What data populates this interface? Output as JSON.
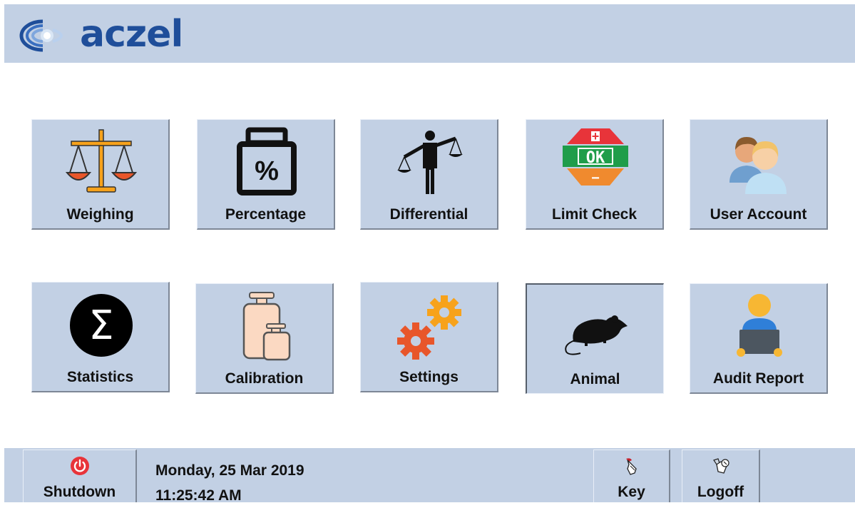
{
  "brand": {
    "name": "aczel"
  },
  "tiles": [
    {
      "label": "Weighing",
      "icon": "balance-scale-icon"
    },
    {
      "label": "Percentage",
      "icon": "percent-weight-icon"
    },
    {
      "label": "Differential",
      "icon": "person-scale-icon"
    },
    {
      "label": "Limit Check",
      "icon": "limit-check-icon"
    },
    {
      "label": "User Account",
      "icon": "users-icon"
    },
    {
      "label": "Statistics",
      "icon": "sigma-icon"
    },
    {
      "label": "Calibration",
      "icon": "calibration-weights-icon"
    },
    {
      "label": "Settings",
      "icon": "gears-icon"
    },
    {
      "label": "Animal",
      "icon": "rat-icon"
    },
    {
      "label": "Audit Report",
      "icon": "auditor-icon"
    }
  ],
  "limit_check_badge": {
    "plus": "+",
    "ok": "OK",
    "minus": "−"
  },
  "percent_symbol": "%",
  "sigma_symbol": "Σ",
  "footer": {
    "shutdown_label": "Shutdown",
    "date": "Monday, 25 Mar 2019",
    "time": "11:25:42 AM",
    "key_label": "Key",
    "logoff_label": "Logoff"
  },
  "colors": {
    "panel": "#c2d0e4",
    "brand_blue": "#1f4e9a",
    "ok_green": "#1f9d4a",
    "stop_red": "#e8343a",
    "orange": "#f08a2e"
  }
}
